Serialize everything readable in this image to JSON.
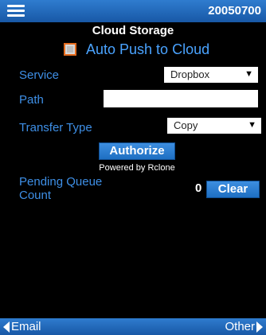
{
  "header": {
    "menu_icon": "hamburger-menu-icon",
    "device_id": "20050700"
  },
  "page": {
    "title": "Cloud Storage"
  },
  "auto_push": {
    "label": "Auto Push to Cloud",
    "checked": false
  },
  "service": {
    "label": "Service",
    "value": "Dropbox"
  },
  "path": {
    "label": "Path",
    "value": ""
  },
  "transfer_type": {
    "label": "Transfer Type",
    "value": "Copy"
  },
  "authorize": {
    "label": "Authorize",
    "powered_by": "Powered by Rclone"
  },
  "pending": {
    "label": "Pending Queue Count",
    "count": "0",
    "clear_label": "Clear"
  },
  "footer": {
    "prev_label": "Email",
    "next_label": "Other"
  },
  "colors": {
    "bar": "#1f66b8",
    "accent_text": "#3e8fe6",
    "checkbox_border": "#e36a1d"
  }
}
